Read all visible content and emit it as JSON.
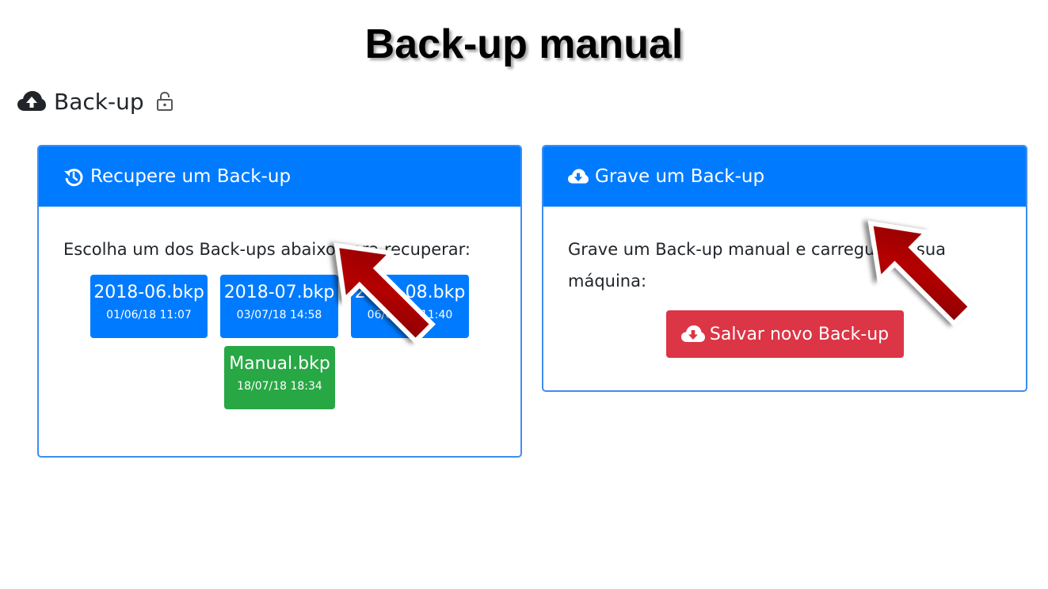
{
  "slide_title": "Back-up manual",
  "page": {
    "heading": "Back-up",
    "heading_icon": "cloud-upload-icon",
    "lock_icon": "unlock-icon"
  },
  "restore_card": {
    "title": "Recupere um Back-up",
    "icon": "history-icon",
    "description": "Escolha um dos Back-ups abaixo para recuperar:",
    "backups": [
      {
        "name": "2018-06.bkp",
        "date": "01/06/18 11:07",
        "color": "#007bff"
      },
      {
        "name": "2018-07.bkp",
        "date": "03/07/18 14:58",
        "color": "#007bff"
      },
      {
        "name": "2018-08.bkp",
        "date": "06/08/18 11:40",
        "color": "#007bff"
      },
      {
        "name": "Manual.bkp",
        "date": "18/07/18 18:34",
        "color": "#28a745"
      }
    ]
  },
  "save_card": {
    "title": "Grave um Back-up",
    "icon": "cloud-download-icon",
    "description": "Grave um Back-up manual e carregue na sua máquina:",
    "button_label": "Salvar novo Back-up",
    "button_color": "#dc3545"
  },
  "colors": {
    "primary": "#007bff",
    "success": "#28a745",
    "danger": "#dc3545",
    "annotation_arrow": "#a00000"
  }
}
